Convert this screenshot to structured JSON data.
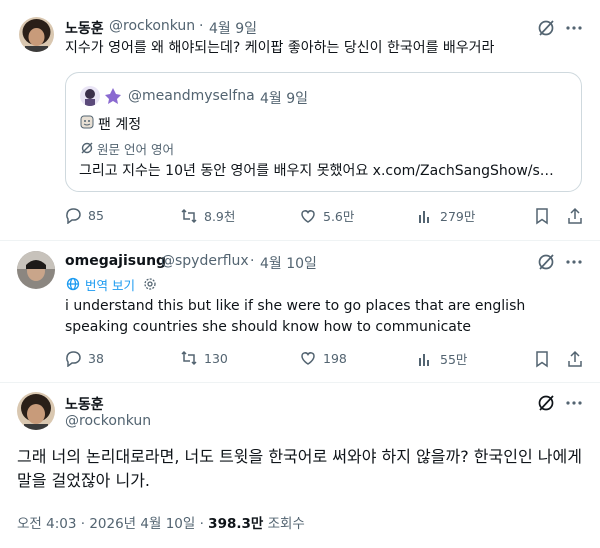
{
  "tweet1": {
    "name": "노동훈",
    "handle": "@rockonkun",
    "dot": "·",
    "date": "4월 9일",
    "text": "지수가 영어를 왜 해야되는데? 케이팝 좋아하는 당신이 한국어를 배우거라",
    "quote": {
      "handle": "@meandmyselfna",
      "date": "4월 9일",
      "badge": "팬 계정",
      "translate": "원문 언어 영어",
      "text": "그리고 지수는 10년 동안 영어를 배우지 못했어요 x.com/ZachSangShow/s…"
    },
    "stats": {
      "replies": "85",
      "reposts": "8.9천",
      "likes": "5.6만",
      "views": "279만"
    }
  },
  "tweet2": {
    "name": "omegajisung",
    "handle": "@spyderflux",
    "dot": "·",
    "date": "4월 10일",
    "translate": "번역 보기",
    "text": "i understand this but like if she were to go places that are english speaking countries she should know how to communicate",
    "stats": {
      "replies": "38",
      "reposts": "130",
      "likes": "198",
      "views": "55만"
    }
  },
  "tweet3": {
    "name": "노동훈",
    "handle": "@rockonkun",
    "text": "그래 너의 논리대로라면, 너도 트윗을 한국어로 써와야 하지 않을까? 한국인인 나에게 말을 걸었잖아 니가.",
    "time": "오전 4:03 · 2026년 4월 10일 · ",
    "views_count": "398.3만",
    "views_label": "조회수"
  },
  "colors": {
    "text": "#0f1419",
    "muted": "#536471",
    "border": "#cfd9de",
    "accent": "#1d9bf0"
  }
}
